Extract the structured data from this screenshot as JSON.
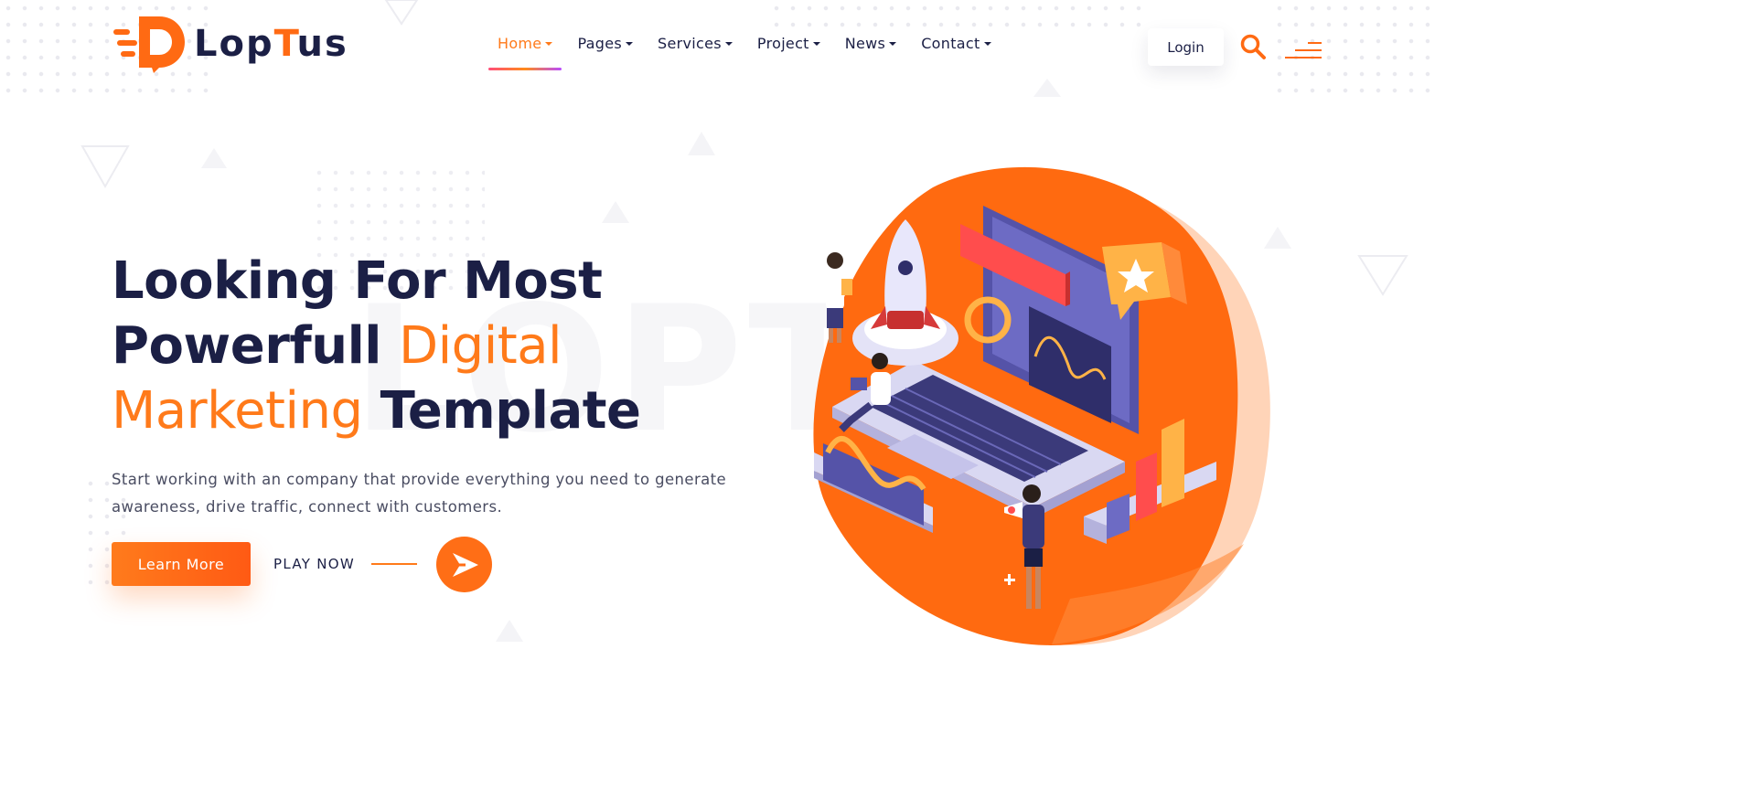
{
  "brand": {
    "name_part1": "Lop",
    "name_part2": "T",
    "name_part3": "us",
    "accent_color": "#ff6a13",
    "dark_color": "#1b1f45"
  },
  "nav": {
    "items": [
      {
        "label": "Home",
        "active": true
      },
      {
        "label": "Pages",
        "active": false
      },
      {
        "label": "Services",
        "active": false
      },
      {
        "label": "Project",
        "active": false
      },
      {
        "label": "News",
        "active": false
      },
      {
        "label": "Contact",
        "active": false
      }
    ]
  },
  "header_actions": {
    "login_label": "Login",
    "search_icon": "search-icon",
    "menu_icon": "menu-lines-icon"
  },
  "hero": {
    "title_line1": "Looking For Most",
    "title_line2_a": "Powerfull ",
    "title_line2_b": "Digital",
    "title_line3_a": "Marketing",
    "title_line3_b": " Template",
    "watermark": "LOPT",
    "description": "Start working with an company that provide everything you need to generate awareness, drive traffic, connect with customers.",
    "learn_more_label": "Learn More",
    "play_label": "PLAY NOW",
    "play_icon": "play-arrow-icon"
  }
}
